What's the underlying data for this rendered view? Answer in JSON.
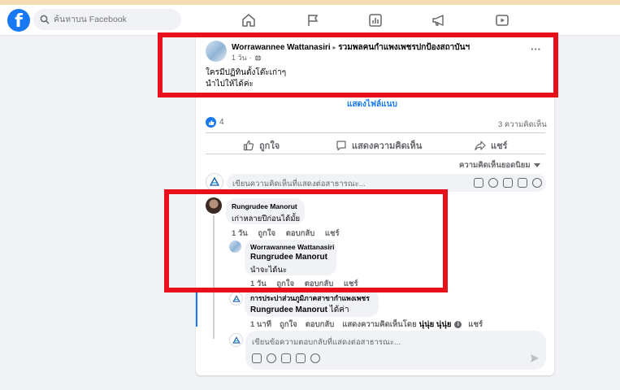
{
  "topbar": {
    "search_placeholder": "ค้นหาบน Facebook"
  },
  "post": {
    "author": "Worrawannee Wattanasiri",
    "separator": "▸",
    "group": "รวมพลคนกำแพงเพชรปกป้องสถาบันฯ",
    "time": "1 วัน",
    "globe": "·",
    "more": "···",
    "body_line1": "ใครมีปฏิทินตั้งโต๊ะเก่าๆ",
    "body_line2": "นำไปให้ได้ค่ะ",
    "see_attachment": "แสดงไฟล์แนบ",
    "reaction_count": "4",
    "comment_count": "3 ความคิดเห็น",
    "like_label": "ถูกใจ",
    "comment_label": "แสดงความคิดเห็น",
    "share_label": "แชร์",
    "sort_label": "ความคิดเห็นยอดนิยม",
    "write_comment_placeholder": "เขียนความคิดเห็นที่แสดงต่อสาธารณะ..."
  },
  "comments": [
    {
      "author": "Rungrudee Manorut",
      "text": "เก่าหลายปีก่อนได้มั้ย",
      "time": "1 วัน",
      "like": "ถูกใจ",
      "reply": "ตอบกลับ",
      "share": "แชร์"
    },
    {
      "author": "Worrawannee Wattanasiri",
      "mention": "Rungrudee Manorut",
      "text": "นำจะได้นะ",
      "time": "1 วัน",
      "like": "ถูกใจ",
      "reply": "ตอบกลับ",
      "share": "แชร์"
    },
    {
      "author": "การประปาส่วนภูมิภาคสาขากำแพงเพชร",
      "mention": "Rungrudee Manorut",
      "text": "ได้ค่า",
      "time": "1 นาที",
      "like": "ถูกใจ",
      "reply": "ตอบกลับ",
      "edited_by_label": "แสดงความคิดเห็นโดย",
      "edited_by": "นุ่นุ่ย นุ่นุ่ย",
      "share": "แชร์"
    }
  ],
  "reply_box": {
    "placeholder": "เขียนข้อความตอบกลับที่แสดงต่อสาธารณะ..."
  },
  "colors": {
    "accent": "#1877f2",
    "highlight_box": "#e8101a",
    "thread_line": "#1877f2"
  }
}
